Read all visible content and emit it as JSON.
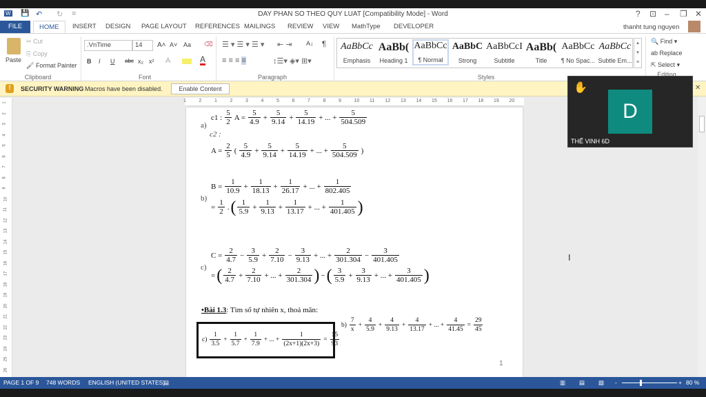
{
  "window": {
    "title": "DAY PHAN SO THEO QUY LUAT [Compatibility Mode] - Word",
    "help": "?",
    "ribbon_display": "⊡",
    "minimize": "–",
    "restore": "❐",
    "close": "✕"
  },
  "quick_access": {
    "word_icon": "W",
    "save": "💾",
    "undo": "↶",
    "redo": "↻",
    "customize": "="
  },
  "tabs": [
    "FILE",
    "HOME",
    "INSERT",
    "DESIGN",
    "PAGE LAYOUT",
    "REFERENCES",
    "MAILINGS",
    "REVIEW",
    "VIEW",
    "MathType",
    "DEVELOPER"
  ],
  "user": {
    "name": "thanht tung nguyen"
  },
  "clipboard": {
    "paste": "Paste",
    "cut": "Cut",
    "copy": "Copy",
    "format_painter": "Format Painter",
    "label": "Clipboard"
  },
  "font": {
    "name": ".VnTime",
    "size": "14",
    "bold": "B",
    "italic": "I",
    "underline": "U",
    "strike": "abc",
    "sub": "x₂",
    "sup": "x²",
    "grow": "A˄",
    "shrink": "A˅",
    "case": "Aa",
    "label": "Font"
  },
  "paragraph": {
    "label": "Paragraph",
    "pilcrow": "¶",
    "sort": "A↓"
  },
  "styles": {
    "label": "Styles",
    "items": [
      {
        "preview": "AaBbCc",
        "name": "Emphasis"
      },
      {
        "preview": "AaBb(",
        "name": "Heading 1"
      },
      {
        "preview": "AaBbCc",
        "name": "¶ Normal"
      },
      {
        "preview": "AaBbC",
        "name": "Strong"
      },
      {
        "preview": "AaBbCcI",
        "name": "Subtitle"
      },
      {
        "preview": "AaBb(",
        "name": "Title"
      },
      {
        "preview": "AaBbCc",
        "name": "¶ No Spac..."
      },
      {
        "preview": "AaBbCc",
        "name": "Subtle Em..."
      }
    ]
  },
  "editing": {
    "find": "Find",
    "replace": "Replace",
    "select": "Select",
    "label": "Editing"
  },
  "security": {
    "title": "SECURITY WARNING",
    "message": "Macros have been disabled.",
    "button": "Enable Content"
  },
  "ruler": {
    "marks": [
      "1",
      "2",
      "1",
      "2",
      "3",
      "4",
      "5",
      "6",
      "7",
      "8",
      "9",
      "10",
      "11",
      "12",
      "13",
      "14",
      "15",
      "16",
      "17",
      "18",
      "19",
      "20"
    ]
  },
  "vruler": {
    "marks": [
      "1",
      "2",
      "3",
      "4",
      "5",
      "6",
      "7",
      "8",
      "9",
      "10",
      "11",
      "12",
      "13",
      "14",
      "15",
      "16",
      "17",
      "18",
      "19",
      "20",
      "21",
      "22",
      "23",
      "24",
      "25",
      "26"
    ]
  },
  "document": {
    "label_a": "a)",
    "label_b": "b)",
    "label_c": "c)",
    "c2": "c2 :",
    "line_a1": [
      "c1 : ",
      {
        "f": [
          "5",
          "2"
        ]
      },
      "A = ",
      {
        "f": [
          "5",
          "4.9"
        ]
      },
      "+",
      {
        "f": [
          "5",
          "9.14"
        ]
      },
      "+",
      {
        "f": [
          "5",
          "14.19"
        ]
      },
      "+ ... +",
      {
        "f": [
          "5",
          "504.509"
        ]
      }
    ],
    "line_a2": [
      "A = ",
      {
        "f": [
          "2",
          "5"
        ]
      },
      "(",
      {
        "f": [
          "5",
          "4.9"
        ]
      },
      "+",
      {
        "f": [
          "5",
          "9.14"
        ]
      },
      "+",
      {
        "f": [
          "5",
          "14.19"
        ]
      },
      "+ ... +",
      {
        "f": [
          "5",
          "504.509"
        ]
      },
      ")"
    ],
    "line_b1": [
      "B = ",
      {
        "f": [
          "1",
          "10.9"
        ]
      },
      "+",
      {
        "f": [
          "1",
          "18.13"
        ]
      },
      "+",
      {
        "f": [
          "1",
          "26.17"
        ]
      },
      "+ ... +",
      {
        "f": [
          "1",
          "802.405"
        ]
      }
    ],
    "line_b2": [
      "= ",
      {
        "f": [
          "1",
          "2"
        ]
      },
      ".",
      {
        "p": "("
      },
      {
        "f": [
          "1",
          "5.9"
        ]
      },
      "+",
      {
        "f": [
          "1",
          "9.13"
        ]
      },
      "+",
      {
        "f": [
          "1",
          "13.17"
        ]
      },
      "+ ... +",
      {
        "f": [
          "1",
          "401.405"
        ]
      },
      {
        "p": ")"
      }
    ],
    "line_c1": [
      "C = ",
      {
        "f": [
          "2",
          "4.7"
        ]
      },
      "−",
      {
        "f": [
          "3",
          "5.9"
        ]
      },
      "+",
      {
        "f": [
          "2",
          "7.10"
        ]
      },
      "−",
      {
        "f": [
          "3",
          "9.13"
        ]
      },
      "+ ... +",
      {
        "f": [
          "2",
          "301.304"
        ]
      },
      "−",
      {
        "f": [
          "3",
          "401.405"
        ]
      }
    ],
    "line_c2": [
      "= ",
      {
        "p": "("
      },
      {
        "f": [
          "2",
          "4.7"
        ]
      },
      "+",
      {
        "f": [
          "2",
          "7.10"
        ]
      },
      "+ ... +",
      {
        "f": [
          "2",
          "301.304"
        ]
      },
      {
        "p": ")"
      },
      "−",
      {
        "p": "("
      },
      {
        "f": [
          "3",
          "5.9"
        ]
      },
      "+",
      {
        "f": [
          "3",
          "9.13"
        ]
      },
      "+ ... +",
      {
        "f": [
          "3",
          "401.405"
        ]
      },
      {
        "p": ")"
      }
    ],
    "exercise_title": "•Bài 1.3",
    "exercise_text": ": Tìm số tự nhiên x, thoả mãn:",
    "line_ex_c": [
      "c)  ",
      {
        "f": [
          "1",
          "3.5"
        ]
      },
      "+",
      {
        "f": [
          "1",
          "5.7"
        ]
      },
      "+",
      {
        "f": [
          "1",
          "7.9"
        ]
      },
      "+ ... +",
      {
        "f": [
          "1",
          "(2x+1)(2x+3)"
        ]
      },
      "=",
      {
        "f": [
          "15",
          "93"
        ]
      }
    ],
    "line_ex_b": [
      "b)  ",
      {
        "f": [
          "7",
          "x"
        ]
      },
      "+",
      {
        "f": [
          "4",
          "5.9"
        ]
      },
      "+",
      {
        "f": [
          "4",
          "9.13"
        ]
      },
      "+",
      {
        "f": [
          "4",
          "13.17"
        ]
      },
      "+ ... +",
      {
        "f": [
          "4",
          "41.45"
        ]
      },
      "=",
      {
        "f": [
          "29",
          "45"
        ]
      }
    ],
    "page_number": "1"
  },
  "status": {
    "page": "PAGE 1 OF 9",
    "words": "748 WORDS",
    "language": "ENGLISH (UNITED STATES)",
    "zoom": "80 %"
  },
  "participant": {
    "initial": "D",
    "name": "THẾ VINH 6D",
    "hand": "✋",
    "tile_color": "#0e8a7e"
  },
  "colors": {
    "accent": "#2b579a"
  }
}
